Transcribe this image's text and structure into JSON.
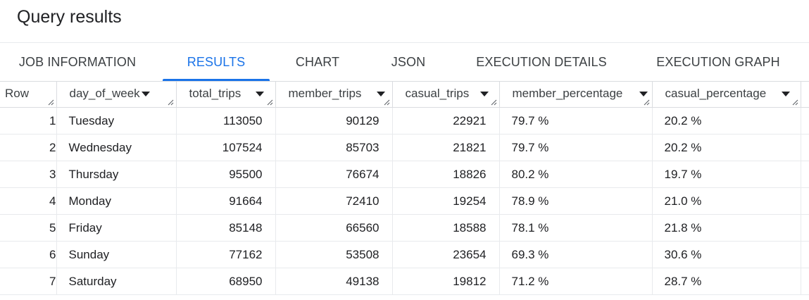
{
  "page": {
    "title": "Query results"
  },
  "tabs": [
    {
      "label": "JOB INFORMATION",
      "active": false
    },
    {
      "label": "RESULTS",
      "active": true
    },
    {
      "label": "CHART",
      "active": false
    },
    {
      "label": "JSON",
      "active": false
    },
    {
      "label": "EXECUTION DETAILS",
      "active": false
    },
    {
      "label": "EXECUTION GRAPH",
      "active": false
    }
  ],
  "colors": {
    "accent": "#1a73e8",
    "text": "#202124",
    "border": "#dadce0"
  },
  "table": {
    "row_header": "Row",
    "columns": [
      {
        "name": "day_of_week",
        "icon": "chevron-down-icon"
      },
      {
        "name": "total_trips",
        "icon": "chevron-down-icon"
      },
      {
        "name": "member_trips",
        "icon": "chevron-down-icon"
      },
      {
        "name": "casual_trips",
        "icon": "chevron-down-icon"
      },
      {
        "name": "member_percentage",
        "icon": "chevron-down-icon"
      },
      {
        "name": "casual_percentage",
        "icon": "chevron-down-icon"
      }
    ],
    "rows": [
      {
        "row": "1",
        "day_of_week": "Tuesday",
        "total_trips": "113050",
        "member_trips": "90129",
        "casual_trips": "22921",
        "member_percentage": "79.7 %",
        "casual_percentage": "20.2 %"
      },
      {
        "row": "2",
        "day_of_week": "Wednesday",
        "total_trips": "107524",
        "member_trips": "85703",
        "casual_trips": "21821",
        "member_percentage": "79.7 %",
        "casual_percentage": "20.2 %"
      },
      {
        "row": "3",
        "day_of_week": "Thursday",
        "total_trips": "95500",
        "member_trips": "76674",
        "casual_trips": "18826",
        "member_percentage": "80.2 %",
        "casual_percentage": "19.7 %"
      },
      {
        "row": "4",
        "day_of_week": "Monday",
        "total_trips": "91664",
        "member_trips": "72410",
        "casual_trips": "19254",
        "member_percentage": "78.9 %",
        "casual_percentage": "21.0 %"
      },
      {
        "row": "5",
        "day_of_week": "Friday",
        "total_trips": "85148",
        "member_trips": "66560",
        "casual_trips": "18588",
        "member_percentage": "78.1 %",
        "casual_percentage": "21.8 %"
      },
      {
        "row": "6",
        "day_of_week": "Sunday",
        "total_trips": "77162",
        "member_trips": "53508",
        "casual_trips": "23654",
        "member_percentage": "69.3 %",
        "casual_percentage": "30.6 %"
      },
      {
        "row": "7",
        "day_of_week": "Saturday",
        "total_trips": "68950",
        "member_trips": "49138",
        "casual_trips": "19812",
        "member_percentage": "71.2 %",
        "casual_percentage": "28.7 %"
      }
    ]
  }
}
